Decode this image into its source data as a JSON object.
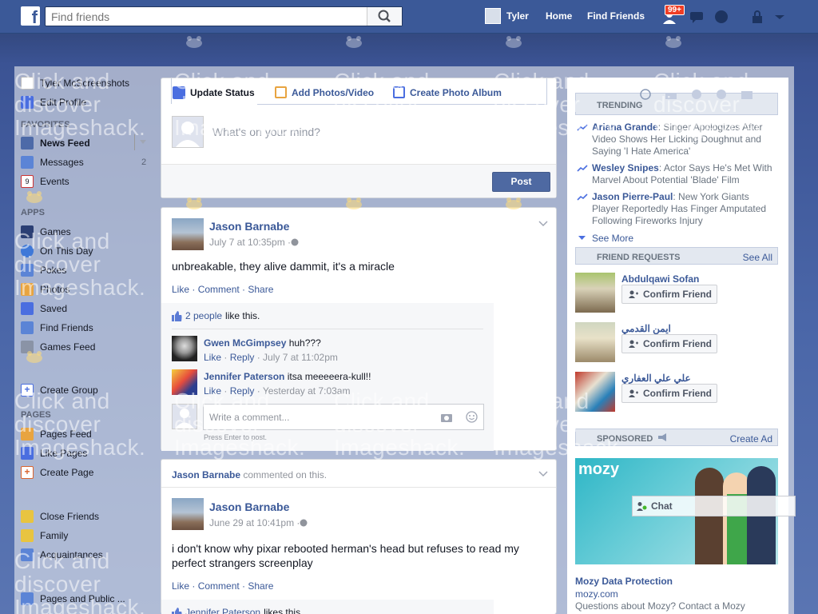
{
  "topbar": {
    "logo": "f",
    "search_placeholder": "Find friends",
    "user_name": "Tyler",
    "home": "Home",
    "find_friends": "Find Friends",
    "badge": "99+"
  },
  "watermark": {
    "text": "Click and\ndiscover\nImageshack."
  },
  "left_nav": {
    "profile_name": "Tyler McScreenshots",
    "edit_profile": "Edit Profile",
    "favorites_head": "FAVORITES",
    "news_feed": "News Feed",
    "messages": "Messages",
    "messages_count": "2",
    "events": "Events",
    "apps_head": "APPS",
    "games": "Games",
    "on_this_day": "On This Day",
    "pokes": "Pokes",
    "photos": "Photos",
    "saved": "Saved",
    "find_friends": "Find Friends",
    "games_feed": "Games Feed",
    "create_group": "Create Group",
    "pages_head": "PAGES",
    "pages_feed": "Pages Feed",
    "like_pages": "Like Pages",
    "create_page": "Create Page",
    "close_friends": "Close Friends",
    "family": "Family",
    "acquaintances": "Acquaintances",
    "pages_public": "Pages and Public ..."
  },
  "composer": {
    "tab_status": "Update Status",
    "tab_photos": "Add Photos/Video",
    "tab_album": "Create Photo Album",
    "placeholder": "What's on your mind?",
    "post_button": "Post"
  },
  "post1": {
    "author": "Jason Barnabe",
    "time": "July 7 at 10:35pm · ",
    "text": "unbreakable, they alive dammit, it's a miracle",
    "like": "Like",
    "comment": "Comment",
    "share": "Share",
    "likes_link": "2 people",
    "likes_rest": " like this.",
    "comments": [
      {
        "author": "Gwen McGimpsey",
        "text": " huh???",
        "like": "Like",
        "reply": "Reply",
        "time": "July 7 at 11:02pm"
      },
      {
        "author": "Jennifer Paterson",
        "text": " itsa meeeeera-kull!!",
        "like": "Like",
        "reply": "Reply",
        "time": "Yesterday at 7:03am"
      }
    ],
    "write_placeholder": "Write a comment...",
    "press_enter": "Press Enter to post."
  },
  "post2": {
    "story_author": "Jason Barnabe",
    "story_rest": " commented on this.",
    "author": "Jason Barnabe",
    "time": "June 29 at 10:41pm · ",
    "text": "i don't know why pixar rebooted herman's head but refuses to read my perfect strangers screenplay",
    "like": "Like",
    "comment": "Comment",
    "share": "Share",
    "likes_author": "Jennifer Paterson",
    "likes_rest": " likes this."
  },
  "trending": {
    "header": "TRENDING",
    "items": [
      {
        "name": "Ariana Grande",
        "text": ": Singer Apologizes After Video Shows Her Licking Doughnut and Saying 'I Hate America'"
      },
      {
        "name": "Wesley Snipes",
        "text": ": Actor Says He's Met With Marvel About Potential 'Blade' Film"
      },
      {
        "name": "Jason Pierre-Paul",
        "text": ": New York Giants Player Reportedly Has Finger Amputated Following Fireworks Injury"
      }
    ],
    "see_more": "See More"
  },
  "friend_requests": {
    "header": "FRIEND REQUESTS",
    "see_all": "See All",
    "items": [
      {
        "name": "Abdulqawi Sofan",
        "button": "Confirm Friend"
      },
      {
        "name": "ايمن القدمي",
        "button": "Confirm Friend"
      },
      {
        "name": "علي علي العفاري",
        "button": "Confirm Friend"
      }
    ]
  },
  "sponsored": {
    "header": "SPONSORED",
    "create_ad": "Create Ad",
    "ad_brand": "mozy",
    "ad_title": "Mozy Data Protection",
    "ad_url": "mozy.com",
    "ad_desc": "Questions about Mozy? Contact a Mozy"
  },
  "chat": {
    "label": "Chat"
  },
  "colors": {
    "brand": "#3b5998",
    "topbar": "#3b5998",
    "badge": "#f03d25"
  }
}
